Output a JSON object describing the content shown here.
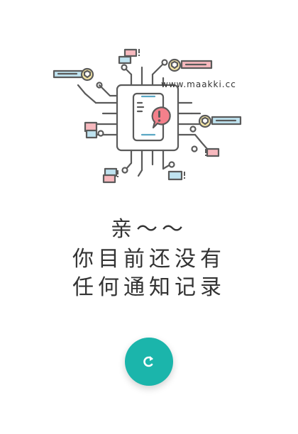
{
  "empty_state": {
    "watermark": "www.maakki.cc",
    "line1": "亲～～",
    "line2": "你目前还没有",
    "line3": "任何通知记录"
  },
  "refresh_button": {
    "icon": "refresh-icon",
    "color": "#1bb5ab"
  },
  "colors": {
    "outline": "#5a5a5a",
    "blue_card": "#bfe3f0",
    "pink_card": "#f7b9be",
    "yellow_badge": "#f6e7a6",
    "alert": "#f4808b"
  }
}
